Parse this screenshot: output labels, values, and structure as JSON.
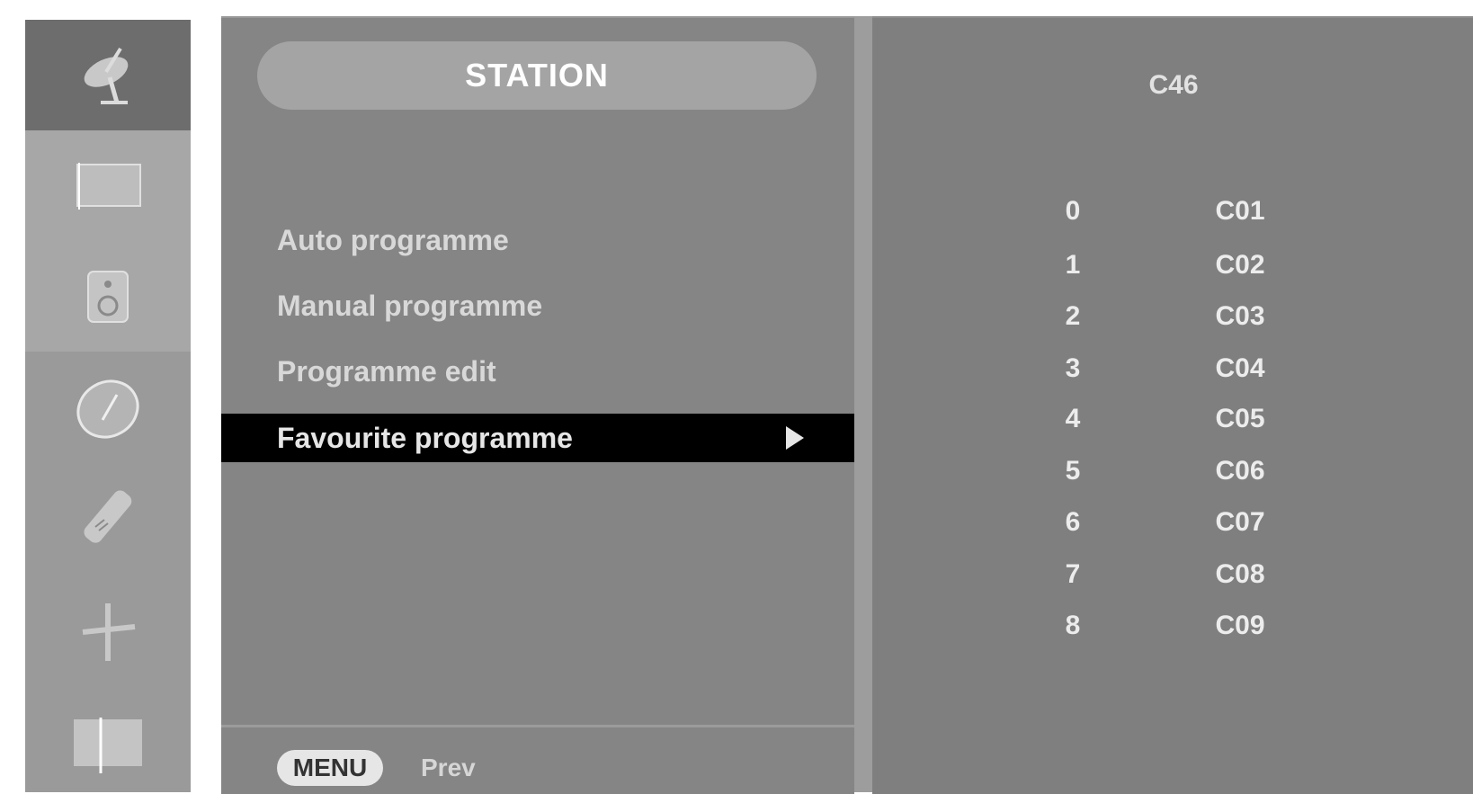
{
  "rail": {
    "items": [
      {
        "icon": "satellite-dish-icon",
        "selected": true
      },
      {
        "icon": "picture-icon",
        "selected": false
      },
      {
        "icon": "sound-icon",
        "selected": false
      },
      {
        "icon": "time-icon",
        "selected": false
      },
      {
        "icon": "special-icon",
        "selected": false
      },
      {
        "icon": "setup-icon",
        "selected": false
      },
      {
        "icon": "screen-icon",
        "selected": false
      }
    ]
  },
  "menu": {
    "title": "STATION",
    "items": [
      {
        "label": "Auto programme"
      },
      {
        "label": "Manual programme"
      },
      {
        "label": "Programme edit"
      },
      {
        "label": "Favourite programme",
        "selected": true
      }
    ]
  },
  "footer": {
    "key_label": "MENU",
    "text": "Prev"
  },
  "programmes": {
    "header": "C46",
    "rows": [
      {
        "number": "0",
        "name": "C01"
      },
      {
        "number": "1",
        "name": "C02"
      },
      {
        "number": "2",
        "name": "C03"
      },
      {
        "number": "3",
        "name": "C04"
      },
      {
        "number": "4",
        "name": "C05"
      },
      {
        "number": "5",
        "name": "C06"
      },
      {
        "number": "6",
        "name": "C07"
      },
      {
        "number": "7",
        "name": "C08"
      },
      {
        "number": "8",
        "name": "C09"
      }
    ]
  },
  "colors": {
    "rail_bg": "#9a9a9a",
    "rail_selected": "#6d6d6d",
    "panel_bg": "#858585",
    "selection_bg": "#000000",
    "text_light": "#e6e6e6"
  }
}
